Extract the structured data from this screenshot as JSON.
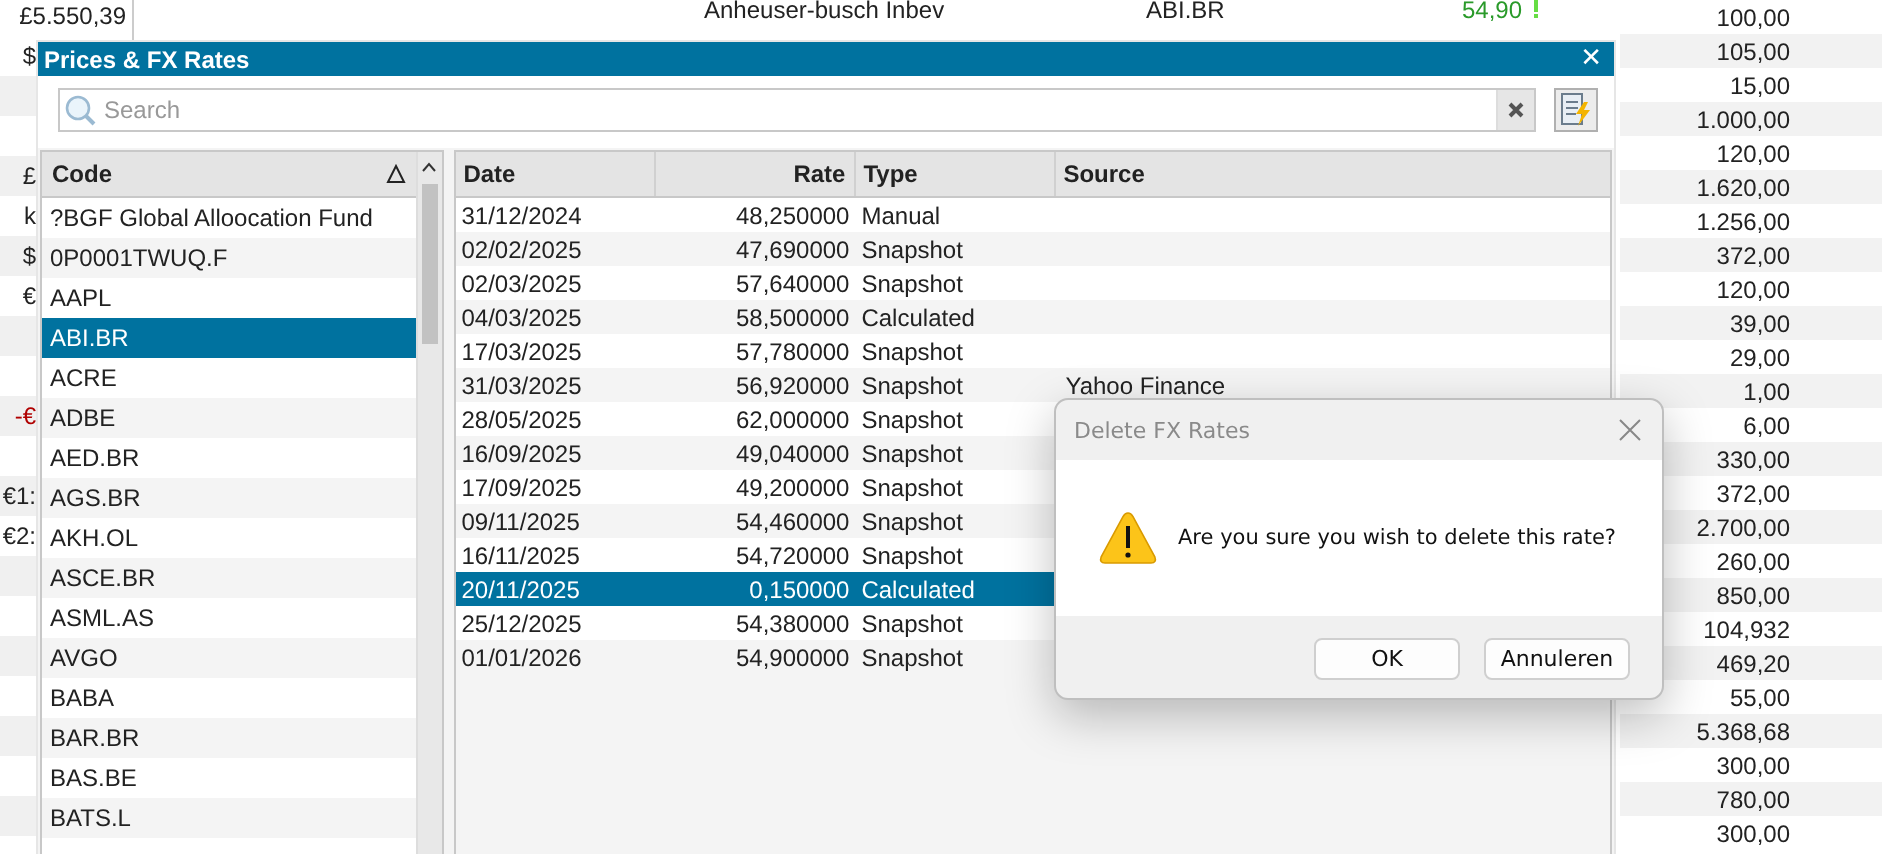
{
  "background": {
    "summary_value": "£5.550,39",
    "left_fragments": [
      {
        "text": "$",
        "negative": false
      },
      {
        "text": "£",
        "negative": false
      },
      {
        "text": "k",
        "negative": false
      },
      {
        "text": "$",
        "negative": false
      },
      {
        "text": "€",
        "negative": false
      },
      {
        "text": "-€",
        "negative": true
      },
      {
        "text": "€1:",
        "negative": false
      },
      {
        "text": "€2:",
        "negative": false
      }
    ],
    "top_row": {
      "name": "Anheuser-busch Inbev",
      "code": "ABI.BR",
      "price": "54,90"
    },
    "quantities": [
      "100,00",
      "105,00",
      "15,00",
      "1.000,00",
      "120,00",
      "1.620,00",
      "1.256,00",
      "372,00",
      "120,00",
      "39,00",
      "29,00",
      "1,00",
      "6,00",
      "330,00",
      "372,00",
      "2.700,00",
      "260,00",
      "850,00",
      "104,932",
      "469,20",
      "55,00",
      "5.368,68",
      "300,00",
      "780,00",
      "300,00"
    ]
  },
  "prices_window": {
    "title": "Prices & FX Rates",
    "close": "✕",
    "search": {
      "placeholder": "Search"
    },
    "code_column": "Code",
    "codes": [
      {
        "label": "?BGF Global Alloocation Fund",
        "selected": false
      },
      {
        "label": "0P0001TWUQ.F",
        "selected": false
      },
      {
        "label": "AAPL",
        "selected": false
      },
      {
        "label": "ABI.BR",
        "selected": true
      },
      {
        "label": "ACRE",
        "selected": false
      },
      {
        "label": "ADBE",
        "selected": false
      },
      {
        "label": "AED.BR",
        "selected": false
      },
      {
        "label": "AGS.BR",
        "selected": false
      },
      {
        "label": "AKH.OL",
        "selected": false
      },
      {
        "label": "ASCE.BR",
        "selected": false
      },
      {
        "label": "ASML.AS",
        "selected": false
      },
      {
        "label": "AVGO",
        "selected": false
      },
      {
        "label": "BABA",
        "selected": false
      },
      {
        "label": "BAR.BR",
        "selected": false
      },
      {
        "label": "BAS.BE",
        "selected": false
      },
      {
        "label": "BATS.L",
        "selected": false
      }
    ],
    "rate_columns": [
      "Date",
      "Rate",
      "Type",
      "Source"
    ],
    "rates": [
      {
        "date": "31/12/2024",
        "rate": "48,250000",
        "type": "Manual",
        "selected": false
      },
      {
        "date": "02/02/2025",
        "rate": "47,690000",
        "type": "Snapshot",
        "selected": false
      },
      {
        "date": "02/03/2025",
        "rate": "57,640000",
        "type": "Snapshot",
        "selected": false
      },
      {
        "date": "04/03/2025",
        "rate": "58,500000",
        "type": "Calculated",
        "selected": false
      },
      {
        "date": "17/03/2025",
        "rate": "57,780000",
        "type": "Snapshot",
        "selected": false
      },
      {
        "date": "31/03/2025",
        "rate": "56,920000",
        "type": "Snapshot",
        "source": "Yahoo Finance",
        "selected": false
      },
      {
        "date": "28/05/2025",
        "rate": "62,000000",
        "type": "Snapshot",
        "selected": false
      },
      {
        "date": "16/09/2025",
        "rate": "49,040000",
        "type": "Snapshot",
        "selected": false
      },
      {
        "date": "17/09/2025",
        "rate": "49,200000",
        "type": "Snapshot",
        "selected": false
      },
      {
        "date": "09/11/2025",
        "rate": "54,460000",
        "type": "Snapshot",
        "selected": false
      },
      {
        "date": "16/11/2025",
        "rate": "54,720000",
        "type": "Snapshot",
        "selected": false
      },
      {
        "date": "20/11/2025",
        "rate": "0,150000",
        "type": "Calculated",
        "selected": true
      },
      {
        "date": "25/12/2025",
        "rate": "54,380000",
        "type": "Snapshot",
        "selected": false
      },
      {
        "date": "01/01/2026",
        "rate": "54,900000",
        "type": "Snapshot",
        "selected": false
      }
    ]
  },
  "confirm_dialog": {
    "title": "Delete FX Rates",
    "message": "Are you sure you wish to delete this rate?",
    "buttons": [
      "OK",
      "Annuleren"
    ]
  }
}
